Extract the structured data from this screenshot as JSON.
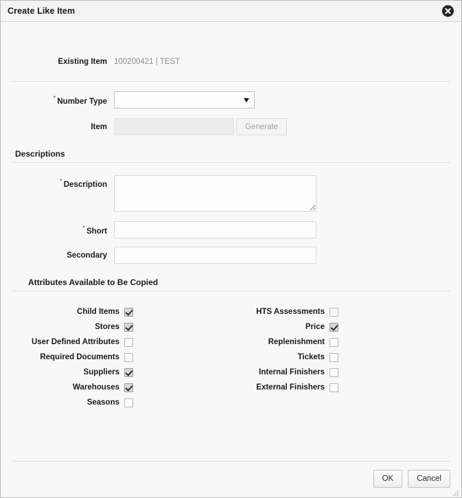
{
  "dialog": {
    "title": "Create Like Item",
    "close_icon": "close-circle-icon"
  },
  "existing": {
    "label": "Existing Item",
    "value": "100200421 | TEST"
  },
  "number_type": {
    "label": "Number Type",
    "required_marker": "*",
    "value": "",
    "options": [
      ""
    ]
  },
  "item": {
    "label": "Item",
    "value": "",
    "placeholder": "",
    "generate_label": "Generate"
  },
  "descriptions": {
    "section_title": "Descriptions",
    "description": {
      "label": "Description",
      "required_marker": "*",
      "value": "",
      "placeholder": ""
    },
    "short": {
      "label": "Short",
      "required_marker": "*",
      "value": "",
      "placeholder": ""
    },
    "secondary": {
      "label": "Secondary",
      "value": "",
      "placeholder": ""
    }
  },
  "attributes": {
    "section_title": "Attributes Available to Be Copied",
    "left_column": [
      {
        "label": "Child Items",
        "checked": true
      },
      {
        "label": "Stores",
        "checked": true
      },
      {
        "label": "User Defined Attributes",
        "checked": false
      },
      {
        "label": "Required Documents",
        "checked": false
      },
      {
        "label": "Suppliers",
        "checked": true
      },
      {
        "label": "Warehouses",
        "checked": true
      },
      {
        "label": "Seasons",
        "checked": false
      }
    ],
    "right_column": [
      {
        "label": "HTS Assessments",
        "checked": false
      },
      {
        "label": "Price",
        "checked": true
      },
      {
        "label": "Replenishment",
        "checked": false
      },
      {
        "label": "Tickets",
        "checked": false
      },
      {
        "label": "Internal Finishers",
        "checked": false
      },
      {
        "label": "External Finishers",
        "checked": false
      }
    ]
  },
  "footer": {
    "ok_label": "OK",
    "cancel_label": "Cancel",
    "resize_grip_icon": "resize-grip-icon"
  },
  "colors": {
    "required_asterisk": "#3a6fbf",
    "title_bar_bg": "#f3f3f3",
    "dialog_bg": "#f8f8f8",
    "readonly_text": "#8c8c8c"
  }
}
